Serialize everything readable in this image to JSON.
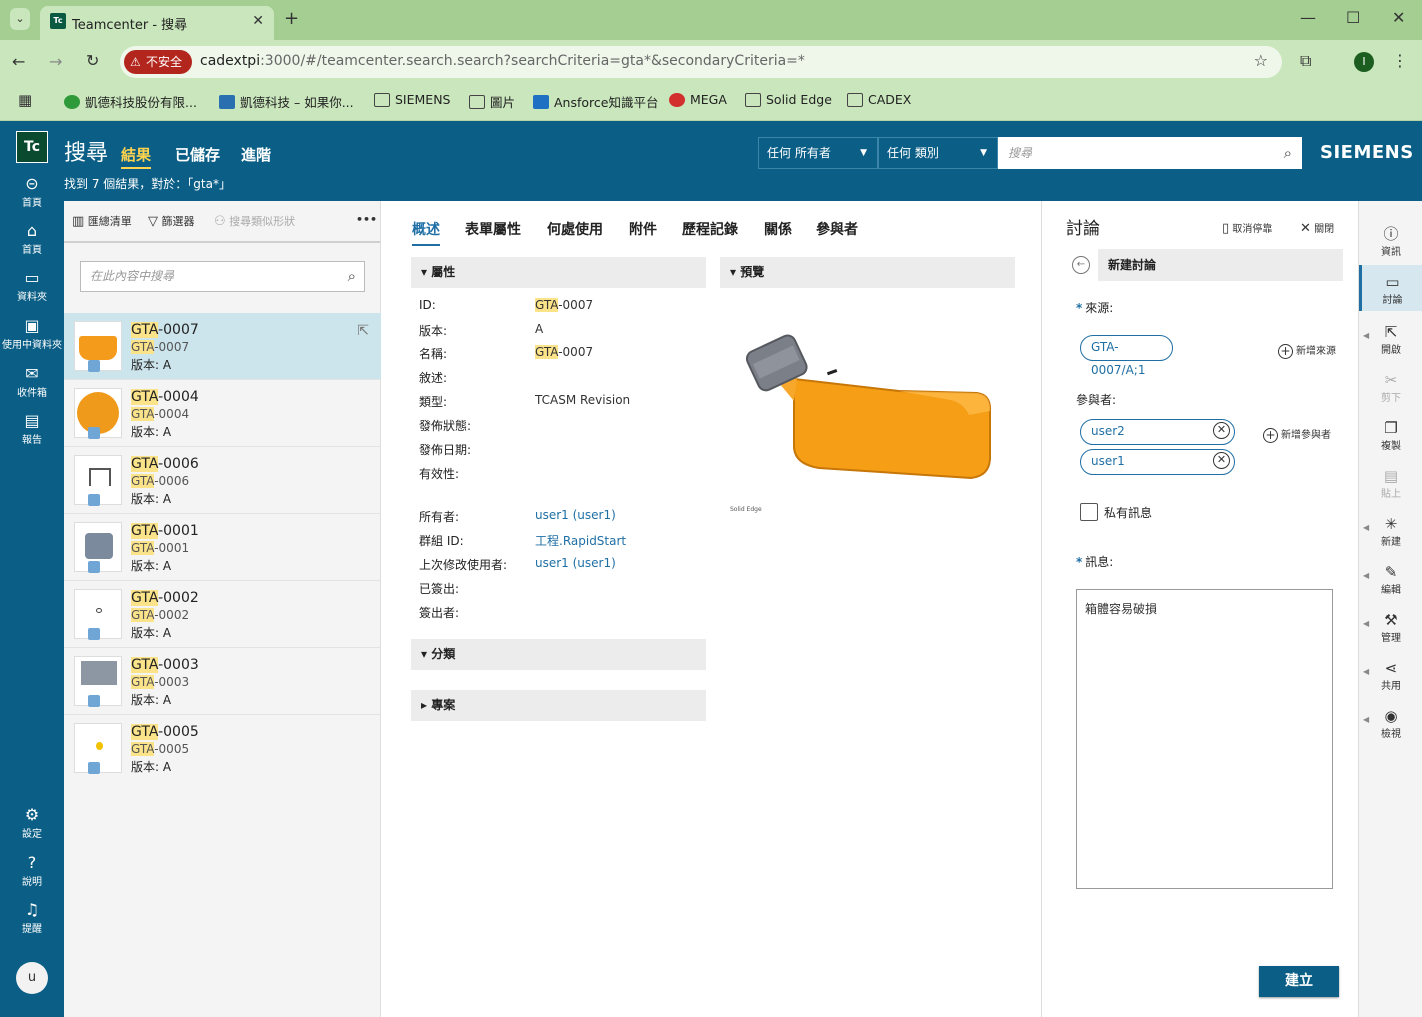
{
  "browser": {
    "tab_title": "Teamcenter - 搜尋",
    "tab_favicon": "Tc",
    "new_tab": "+",
    "security_badge": "不安全",
    "url_host": "cadextpi",
    "url_rest": ":3000/#/teamcenter.search.search?searchCriteria=gta*&secondaryCriteria=*",
    "profile_initial": "I",
    "bookmarks": [
      {
        "label": "凱德科技股份有限...",
        "icon": "green-p-icon"
      },
      {
        "label": "凱德科技 – 如果你...",
        "icon": "site-icon"
      },
      {
        "label": "SIEMENS",
        "icon": "folder-icon"
      },
      {
        "label": "圖片",
        "icon": "folder-icon"
      },
      {
        "label": "Ansforce知識平台",
        "icon": "rss-icon"
      },
      {
        "label": "MEGA",
        "icon": "mega-icon"
      },
      {
        "label": "Solid Edge",
        "icon": "folder-icon"
      },
      {
        "label": "CADEX",
        "icon": "folder-icon"
      }
    ]
  },
  "app": {
    "logo": "Tc",
    "title": "搜尋",
    "tabs": [
      {
        "label": "結果"
      },
      {
        "label": "已儲存"
      },
      {
        "label": "進階"
      }
    ],
    "found_text": "找到 7 個結果，對於：「gta*」",
    "owner_select": "任何 所有者",
    "type_select": "任何 類別",
    "search_placeholder": "搜尋",
    "brand": "SIEMENS"
  },
  "leftnav": [
    {
      "label": "首頁",
      "icon": "back-home-icon"
    },
    {
      "label": "首頁",
      "icon": "home-icon"
    },
    {
      "label": "資料夾",
      "icon": "folder-icon"
    },
    {
      "label": "使用中資料夾",
      "icon": "active-folder-icon"
    },
    {
      "label": "收件箱",
      "icon": "inbox-icon"
    },
    {
      "label": "報告",
      "icon": "report-icon"
    },
    {
      "label": "設定",
      "icon": "gear-icon"
    },
    {
      "label": "說明",
      "icon": "help-icon"
    },
    {
      "label": "提醒",
      "icon": "bell-icon"
    }
  ],
  "user_initial": "u",
  "list_toolbar": {
    "compact": "匯總清單",
    "filter": "篩選器",
    "shape_search": "搜尋類似形狀",
    "more": "•••",
    "search_placeholder": "在此內容中搜尋"
  },
  "results": [
    {
      "hl": "GTA",
      "title_rest": "-0007",
      "sub_hl": "GTA",
      "sub_rest": "-0007",
      "rev": "版本:  A"
    },
    {
      "hl": "GTA",
      "title_rest": "-0004",
      "sub_hl": "GTA",
      "sub_rest": "-0004",
      "rev": "版本:  A"
    },
    {
      "hl": "GTA",
      "title_rest": "-0006",
      "sub_hl": "GTA",
      "sub_rest": "-0006",
      "rev": "版本:  A"
    },
    {
      "hl": "GTA",
      "title_rest": "-0001",
      "sub_hl": "GTA",
      "sub_rest": "-0001",
      "rev": "版本:  A"
    },
    {
      "hl": "GTA",
      "title_rest": "-0002",
      "sub_hl": "GTA",
      "sub_rest": "-0002",
      "rev": "版本:  A"
    },
    {
      "hl": "GTA",
      "title_rest": "-0003",
      "sub_hl": "GTA",
      "sub_rest": "-0003",
      "rev": "版本:  A"
    },
    {
      "hl": "GTA",
      "title_rest": "-0005",
      "sub_hl": "GTA",
      "sub_rest": "-0005",
      "rev": "版本:  A"
    }
  ],
  "main": {
    "tabs": [
      {
        "label": "概述"
      },
      {
        "label": "表單屬性"
      },
      {
        "label": "何處使用"
      },
      {
        "label": "附件"
      },
      {
        "label": "歷程記錄"
      },
      {
        "label": "關係"
      },
      {
        "label": "參與者"
      }
    ],
    "sections": {
      "props": "▾ 屬性",
      "preview": "▾ 預覽",
      "classify": "▾ 分類",
      "project": "▸ 專案"
    },
    "properties": [
      {
        "label": "ID:",
        "hl": "GTA",
        "value": "-0007"
      },
      {
        "label": "版本:",
        "hl": "",
        "value": "A"
      },
      {
        "label": "名稱:",
        "hl": "GTA",
        "value": "-0007"
      },
      {
        "label": "敘述:",
        "hl": "",
        "value": ""
      },
      {
        "label": "類型:",
        "hl": "",
        "value": "TCASM Revision"
      },
      {
        "label": "發佈狀態:",
        "hl": "",
        "value": ""
      },
      {
        "label": "發佈日期:",
        "hl": "",
        "value": ""
      },
      {
        "label": "有效性:",
        "hl": "",
        "value": ""
      }
    ],
    "owner_props": [
      {
        "label": "所有者:",
        "value": "user1 (user1)"
      },
      {
        "label": "群組 ID:",
        "value": "工程.RapidStart"
      },
      {
        "label": "上次修改使用者:",
        "value": "user1 (user1)"
      },
      {
        "label": "已簽出:",
        "value": ""
      },
      {
        "label": "簽出者:",
        "value": ""
      }
    ],
    "preview_caption": "Solid Edge"
  },
  "discussion": {
    "title": "討論",
    "unsubscribe": "取消停靠",
    "close": "關閉",
    "new_label": "新建討論",
    "source_label": "來源:",
    "source_chip": "GTA-0007/A;1",
    "add_source": "新增來源",
    "participants_label": "參與者:",
    "participants": [
      {
        "name": "user2"
      },
      {
        "name": "user1"
      }
    ],
    "add_participant": "新增參與者",
    "private_label": "私有訊息",
    "private_checked": false,
    "message_label": "訊息:",
    "message_value": "箱體容易破損",
    "create_button": "建立"
  },
  "rail": [
    {
      "label": "資訊",
      "icon": "info-icon",
      "state": "normal"
    },
    {
      "label": "討論",
      "icon": "chat-icon",
      "state": "active"
    },
    {
      "label": "開啟",
      "icon": "open-icon",
      "state": "normal"
    },
    {
      "label": "剪下",
      "icon": "scissors-icon",
      "state": "dim"
    },
    {
      "label": "複製",
      "icon": "copy-icon",
      "state": "normal"
    },
    {
      "label": "貼上",
      "icon": "paste-icon",
      "state": "dim"
    },
    {
      "label": "新建",
      "icon": "new-icon",
      "state": "normal"
    },
    {
      "label": "編輯",
      "icon": "pencil-icon",
      "state": "normal"
    },
    {
      "label": "管理",
      "icon": "tools-icon",
      "state": "normal"
    },
    {
      "label": "共用",
      "icon": "share-icon",
      "state": "normal"
    },
    {
      "label": "檢視",
      "icon": "eye-icon",
      "state": "normal"
    }
  ]
}
